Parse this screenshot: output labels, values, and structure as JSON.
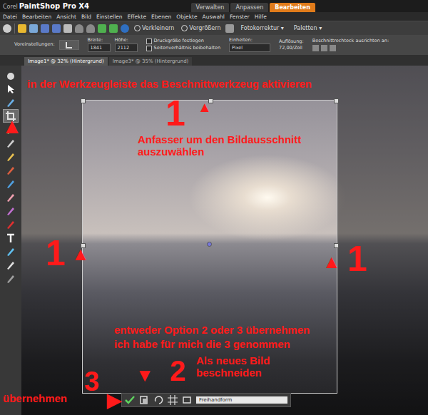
{
  "window": {
    "brand": "Corel",
    "title": "PaintShop Pro X4"
  },
  "mode_tabs": [
    {
      "label": "Verwalten",
      "selected": false
    },
    {
      "label": "Anpassen",
      "selected": false
    },
    {
      "label": "Bearbeiten",
      "selected": true
    }
  ],
  "menu": [
    "Datei",
    "Bearbeiten",
    "Ansicht",
    "Bild",
    "Einstellen",
    "Effekte",
    "Ebenen",
    "Objekte",
    "Auswahl",
    "Fenster",
    "Hilfe"
  ],
  "toolbar": {
    "zoom_out": "Verkleinern",
    "zoom_in": "Vergrößern",
    "dropdowns": [
      {
        "label": "Fotokorrektur",
        "caret": "▾"
      },
      {
        "label": "Paletten",
        "caret": "▾"
      }
    ]
  },
  "tool_options": {
    "presets": "Voreinstellungen:",
    "width_label": "Breite:",
    "width": "1841",
    "height_label": "Höhe:",
    "height": "2112",
    "checkboxes": [
      {
        "label": "Druckgröße festlegen",
        "checked": false
      },
      {
        "label": "Seitenverhältnis beibehalten",
        "checked": false
      }
    ],
    "units_label": "Einheiten:",
    "units": "Pixel",
    "resolution_label": "Auflösung:",
    "resolution": "72,00/Zoll",
    "snap_label": "Beschnittrechteck ausrichten an:"
  },
  "document_tabs": [
    {
      "label": "Image1* @ 32% (Hintergrund)",
      "selected": true
    },
    {
      "label": "Image3* @ 35% (Hintergrund)",
      "selected": false
    }
  ],
  "tools": [
    {
      "kind": "pan",
      "selected": false
    },
    {
      "kind": "pick",
      "selected": false
    },
    {
      "kind": "dropper",
      "selected": false
    },
    {
      "kind": "crop",
      "selected": true
    },
    {
      "kind": "straighten",
      "selected": false
    },
    {
      "kind": "move",
      "selected": false
    },
    {
      "kind": "retouch",
      "selected": false
    },
    {
      "kind": "brush",
      "selected": false
    },
    {
      "kind": "fill",
      "selected": false
    },
    {
      "kind": "eraser",
      "selected": false
    },
    {
      "kind": "clone",
      "selected": false
    },
    {
      "kind": "redeye",
      "selected": false
    },
    {
      "kind": "text",
      "selected": false
    },
    {
      "kind": "shape",
      "selected": false
    },
    {
      "kind": "pen",
      "selected": false
    },
    {
      "kind": "smudge",
      "selected": false
    }
  ],
  "crop_toolbar": {
    "mode": "Freihandform"
  },
  "annotations": [
    {
      "text": "in der Werkzeugleiste das Beschnittwerkzeug aktivieren",
      "kind": "note"
    },
    {
      "text": "▲",
      "kind": "arrow"
    },
    {
      "text": "1",
      "kind": "number"
    },
    {
      "text": "▲",
      "kind": "arrow"
    },
    {
      "text": "Anfasser um den Bildausschnitt auszuwählen",
      "kind": "note"
    },
    {
      "text": "1",
      "kind": "number"
    },
    {
      "text": "▲",
      "kind": "arrow"
    },
    {
      "text": "▲",
      "kind": "arrow"
    },
    {
      "text": "1",
      "kind": "number"
    },
    {
      "text": "entweder Option 2 oder 3 übernehmen",
      "kind": "note"
    },
    {
      "text": "ich habe für mich die 3 genommen",
      "kind": "note"
    },
    {
      "text": "3",
      "kind": "number"
    },
    {
      "text": "▼",
      "kind": "arrow"
    },
    {
      "text": "2",
      "kind": "number"
    },
    {
      "text": "Als neues Bild beschneiden",
      "kind": "note"
    },
    {
      "text": "übernehmen",
      "kind": "note"
    },
    {
      "text": "▶",
      "kind": "arrow"
    }
  ]
}
